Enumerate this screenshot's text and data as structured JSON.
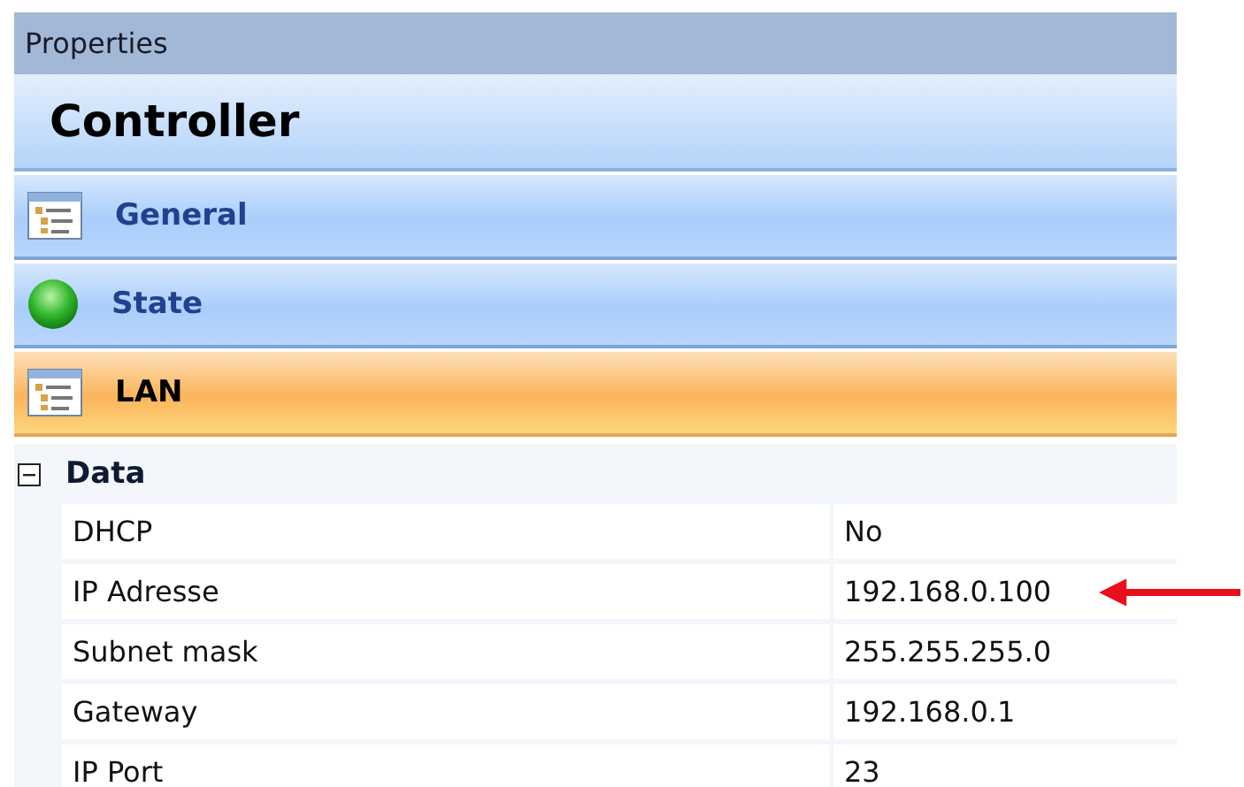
{
  "panel": {
    "title": "Properties",
    "object_name": "Controller"
  },
  "sections": [
    {
      "label": "General",
      "kind": "list",
      "selected": false
    },
    {
      "label": "State",
      "kind": "status",
      "selected": false
    },
    {
      "label": "LAN",
      "kind": "list",
      "selected": true
    }
  ],
  "group": {
    "label": "Data",
    "expanded": true,
    "rows": [
      {
        "name": "DHCP",
        "value": "No",
        "annotated": false
      },
      {
        "name": "IP Adresse",
        "value": "192.168.0.100",
        "annotated": true
      },
      {
        "name": "Subnet mask",
        "value": "255.255.255.0",
        "annotated": false
      },
      {
        "name": "Gateway",
        "value": "192.168.0.1",
        "annotated": false
      },
      {
        "name": "IP Port",
        "value": "23",
        "annotated": false
      }
    ]
  }
}
